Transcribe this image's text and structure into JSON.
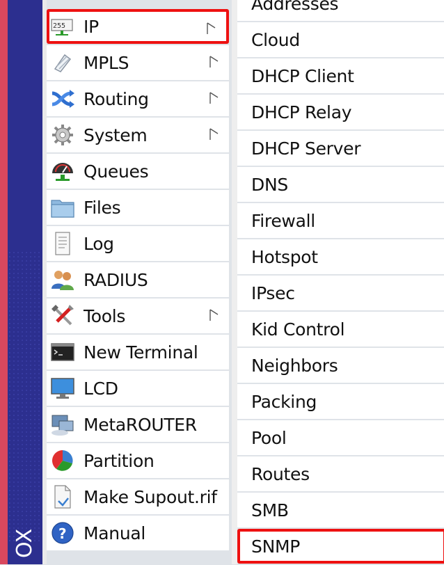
{
  "brand": {
    "partial_text": "OX"
  },
  "menu": {
    "items": [
      {
        "label": "IP",
        "icon": "ip-icon",
        "has_submenu": true,
        "selected": true
      },
      {
        "label": "MPLS",
        "icon": "mpls-icon",
        "has_submenu": true
      },
      {
        "label": "Routing",
        "icon": "routing-icon",
        "has_submenu": true
      },
      {
        "label": "System",
        "icon": "gear-icon",
        "has_submenu": true
      },
      {
        "label": "Queues",
        "icon": "queues-icon",
        "has_submenu": false
      },
      {
        "label": "Files",
        "icon": "folder-icon",
        "has_submenu": false
      },
      {
        "label": "Log",
        "icon": "log-icon",
        "has_submenu": false
      },
      {
        "label": "RADIUS",
        "icon": "users-icon",
        "has_submenu": false
      },
      {
        "label": "Tools",
        "icon": "tools-icon",
        "has_submenu": true
      },
      {
        "label": "New Terminal",
        "icon": "terminal-icon",
        "has_submenu": false
      },
      {
        "label": "LCD",
        "icon": "monitor-icon",
        "has_submenu": false
      },
      {
        "label": "MetaROUTER",
        "icon": "metarouter-icon",
        "has_submenu": false
      },
      {
        "label": "Partition",
        "icon": "pie-chart-icon",
        "has_submenu": false
      },
      {
        "label": "Make Supout.rif",
        "icon": "document-icon",
        "has_submenu": false
      },
      {
        "label": "Manual",
        "icon": "help-icon",
        "has_submenu": false
      }
    ]
  },
  "submenu": {
    "items": [
      {
        "label": "Addresses"
      },
      {
        "label": "Cloud"
      },
      {
        "label": "DHCP Client"
      },
      {
        "label": "DHCP Relay"
      },
      {
        "label": "DHCP Server"
      },
      {
        "label": "DNS"
      },
      {
        "label": "Firewall"
      },
      {
        "label": "Hotspot"
      },
      {
        "label": "IPsec"
      },
      {
        "label": "Kid Control"
      },
      {
        "label": "Neighbors"
      },
      {
        "label": "Packing"
      },
      {
        "label": "Pool"
      },
      {
        "label": "Routes"
      },
      {
        "label": "SMB"
      },
      {
        "label": "SNMP",
        "highlighted": true
      }
    ]
  },
  "colors": {
    "highlight_border": "#ee1111",
    "brand_strip": "#2c2f8f",
    "window_border": "#d9485e"
  }
}
